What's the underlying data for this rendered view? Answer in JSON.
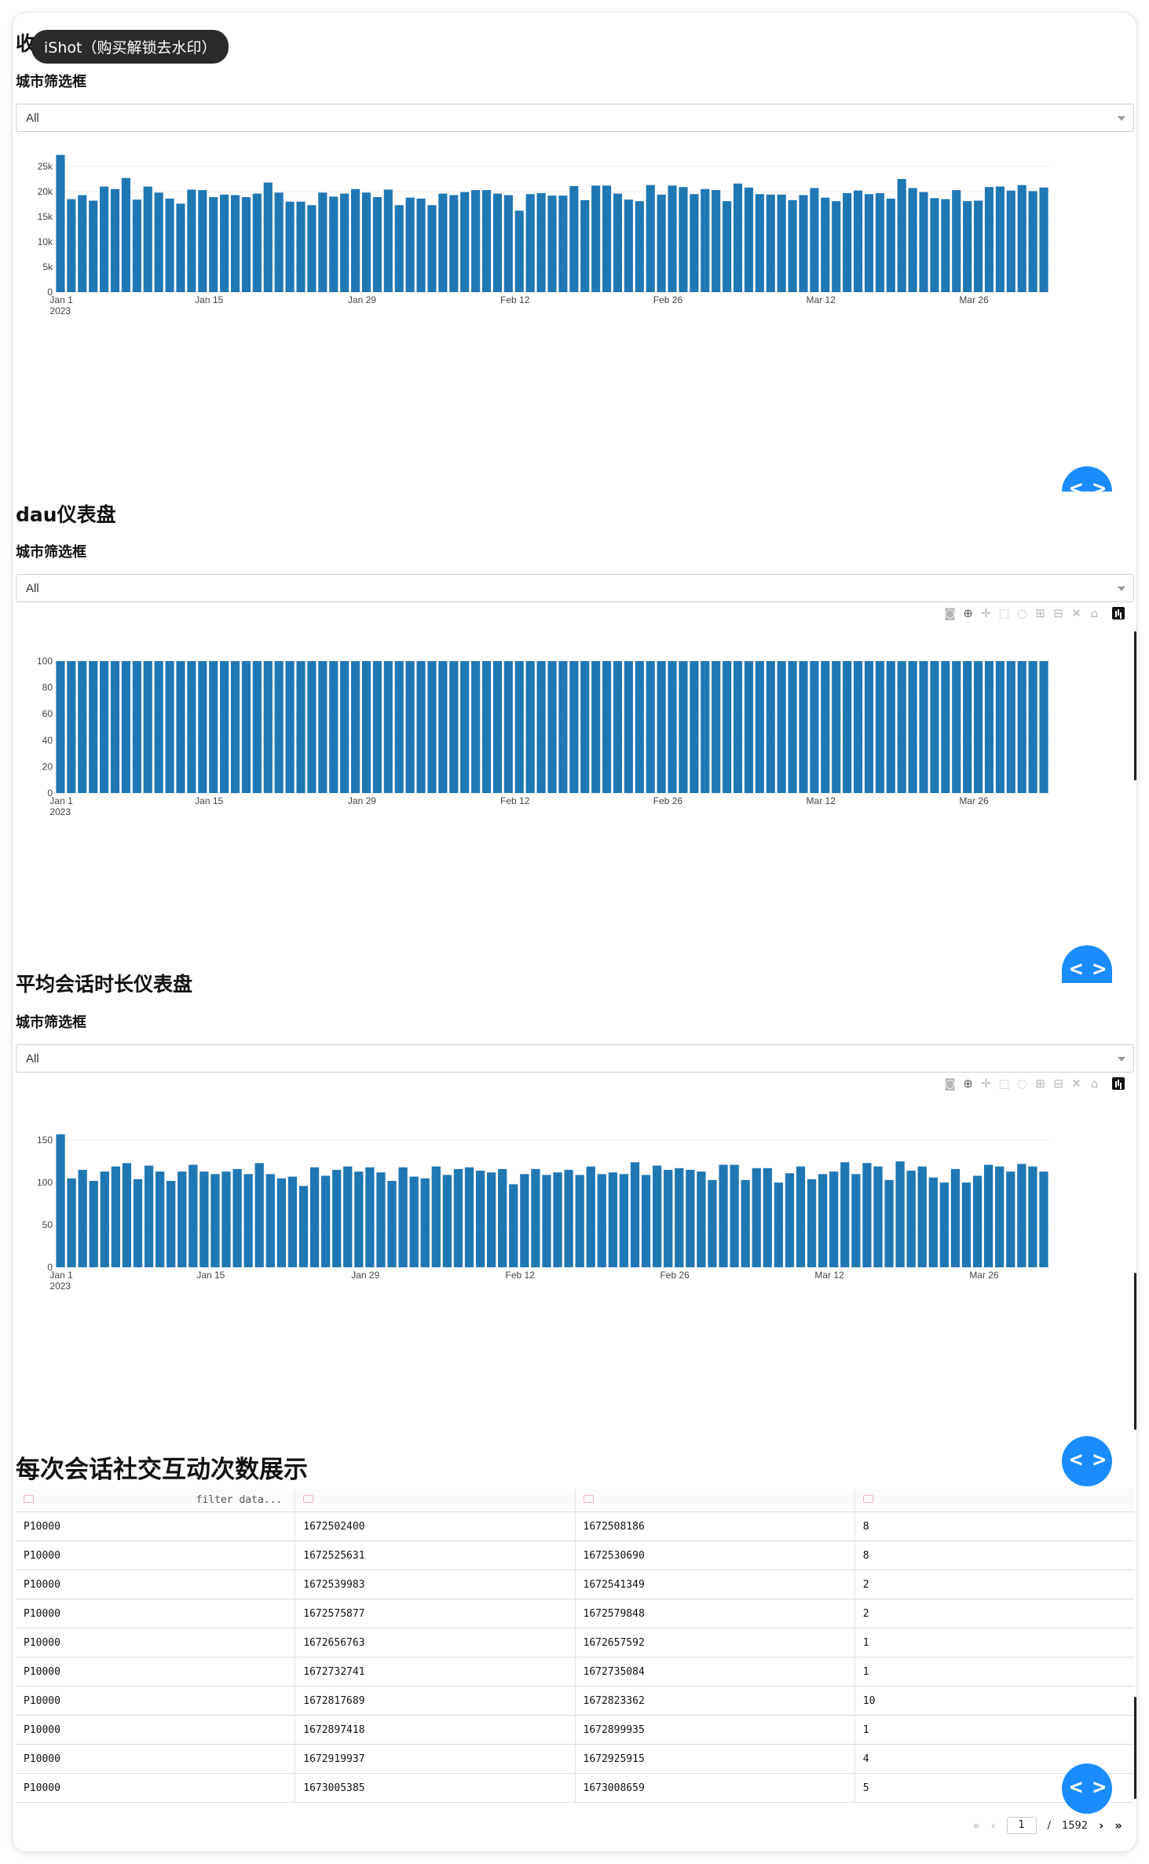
{
  "watermark": "iShot（购买解锁去水印）",
  "sections": [
    {
      "title": "收入仪表盘",
      "filter_label": "城市筛选框",
      "dropdown_value": "All"
    },
    {
      "title": "dau仪表盘",
      "filter_label": "城市筛选框",
      "dropdown_value": "All"
    },
    {
      "title": "平均会话时长仪表盘",
      "filter_label": "城市筛选框",
      "dropdown_value": "All"
    },
    {
      "title": "每次会话社交互动次数展示"
    }
  ],
  "fab_label": "< >",
  "chart_data": [
    {
      "type": "bar",
      "x_start": "2023-01-01",
      "x_end": "2023-04-01",
      "x_ticks": [
        {
          "label": "Jan 1",
          "sub": "2023",
          "day": 0
        },
        {
          "label": "Jan 15",
          "day": 14
        },
        {
          "label": "Jan 29",
          "day": 28
        },
        {
          "label": "Feb 12",
          "day": 42
        },
        {
          "label": "Feb 26",
          "day": 56
        },
        {
          "label": "Mar 12",
          "day": 70
        },
        {
          "label": "Mar 26",
          "day": 84
        }
      ],
      "y_ticks": [
        {
          "label": "0",
          "value": 0
        },
        {
          "label": "5k",
          "value": 5000
        },
        {
          "label": "10k",
          "value": 10000
        },
        {
          "label": "15k",
          "value": 15000
        },
        {
          "label": "20k",
          "value": 20000
        },
        {
          "label": "25k",
          "value": 25000
        }
      ],
      "ylim": [
        0,
        27500
      ],
      "color": "#1f77b4",
      "values": [
        27300,
        18500,
        19300,
        18200,
        21000,
        20500,
        22700,
        18400,
        21000,
        19800,
        18600,
        17600,
        20400,
        20300,
        18900,
        19400,
        19300,
        18900,
        19600,
        21800,
        19800,
        18000,
        18000,
        17300,
        19800,
        19000,
        19600,
        20500,
        19800,
        18900,
        20400,
        17300,
        18800,
        18600,
        17300,
        19600,
        19300,
        19900,
        20300,
        20300,
        19600,
        19300,
        16200,
        19500,
        19700,
        19200,
        19200,
        21100,
        18300,
        21200,
        21200,
        19600,
        18400,
        18100,
        21300,
        19400,
        21200,
        20900,
        19500,
        20500,
        20300,
        18100,
        21600,
        20800,
        19500,
        19400,
        19400,
        18300,
        19300,
        20700,
        18800,
        18100,
        19700,
        20200,
        19500,
        19700,
        18600,
        22500,
        20700,
        19900,
        18700,
        18500,
        20300,
        18100,
        18200,
        20900,
        21000,
        20200,
        21300,
        20100,
        20800
      ]
    },
    {
      "type": "bar",
      "x_start": "2023-01-01",
      "x_end": "2023-04-01",
      "x_ticks": [
        {
          "label": "Jan 1",
          "sub": "2023",
          "day": 0
        },
        {
          "label": "Jan 15",
          "day": 14
        },
        {
          "label": "Jan 29",
          "day": 28
        },
        {
          "label": "Feb 12",
          "day": 42
        },
        {
          "label": "Feb 26",
          "day": 56
        },
        {
          "label": "Mar 12",
          "day": 70
        },
        {
          "label": "Mar 26",
          "day": 84
        }
      ],
      "y_ticks": [
        {
          "label": "0",
          "value": 0
        },
        {
          "label": "20",
          "value": 20
        },
        {
          "label": "40",
          "value": 40
        },
        {
          "label": "60",
          "value": 60
        },
        {
          "label": "80",
          "value": 80
        },
        {
          "label": "100",
          "value": 100
        }
      ],
      "ylim": [
        0,
        100
      ],
      "color": "#1f77b4",
      "constant_value": 100,
      "values": [
        100,
        100,
        100,
        100,
        100,
        100,
        100,
        100,
        100,
        100,
        100,
        100,
        100,
        100,
        100,
        100,
        100,
        100,
        100,
        100,
        100,
        100,
        100,
        100,
        100,
        100,
        100,
        100,
        100,
        100,
        100,
        100,
        100,
        100,
        100,
        100,
        100,
        100,
        100,
        100,
        100,
        100,
        100,
        100,
        100,
        100,
        100,
        100,
        100,
        100,
        100,
        100,
        100,
        100,
        100,
        100,
        100,
        100,
        100,
        100,
        100,
        100,
        100,
        100,
        100,
        100,
        100,
        100,
        100,
        100,
        100,
        100,
        100,
        100,
        100,
        100,
        100,
        100,
        100,
        100,
        100,
        100,
        100,
        100,
        100,
        100,
        100,
        100,
        100,
        100,
        100
      ]
    },
    {
      "type": "bar",
      "x_start": "2023-01-01",
      "x_end": "2023-04-01",
      "x_ticks": [
        {
          "label": "Jan 1",
          "sub": "2023",
          "day": 0
        },
        {
          "label": "Jan 15",
          "day": 14
        },
        {
          "label": "Jan 29",
          "day": 28
        },
        {
          "label": "Feb 12",
          "day": 42
        },
        {
          "label": "Feb 26",
          "day": 56
        },
        {
          "label": "Mar 12",
          "day": 70
        },
        {
          "label": "Mar 26",
          "day": 84
        }
      ],
      "y_ticks": [
        {
          "label": "0",
          "value": 0
        },
        {
          "label": "50",
          "value": 50
        },
        {
          "label": "100",
          "value": 100
        },
        {
          "label": "150",
          "value": 150
        }
      ],
      "ylim": [
        0,
        165
      ],
      "color": "#1f77b4",
      "values": [
        157,
        105,
        115,
        102,
        113,
        119,
        123,
        104,
        120,
        113,
        102,
        113,
        121,
        113,
        110,
        113,
        116,
        110,
        123,
        110,
        105,
        107,
        96,
        118,
        108,
        115,
        119,
        113,
        118,
        112,
        102,
        118,
        107,
        105,
        119,
        109,
        116,
        118,
        114,
        112,
        116,
        98,
        110,
        116,
        109,
        112,
        115,
        109,
        119,
        110,
        112,
        110,
        124,
        109,
        120,
        115,
        117,
        115,
        113,
        103,
        121,
        121,
        103,
        117,
        117,
        100,
        111,
        119,
        104,
        110,
        113,
        124,
        110,
        123,
        119,
        103,
        125,
        114,
        119,
        106,
        100,
        116,
        100,
        108,
        121,
        119,
        113,
        122,
        119,
        113
      ]
    }
  ],
  "table": {
    "filter_placeholder": "filter data...",
    "rows": [
      [
        "P10000",
        "1672502400",
        "1672508186",
        "8"
      ],
      [
        "P10000",
        "1672525631",
        "1672530690",
        "8"
      ],
      [
        "P10000",
        "1672539983",
        "1672541349",
        "2"
      ],
      [
        "P10000",
        "1672575877",
        "1672579848",
        "2"
      ],
      [
        "P10000",
        "1672656763",
        "1672657592",
        "1"
      ],
      [
        "P10000",
        "1672732741",
        "1672735084",
        "1"
      ],
      [
        "P10000",
        "1672817689",
        "1672823362",
        "10"
      ],
      [
        "P10000",
        "1672897418",
        "1672899935",
        "1"
      ],
      [
        "P10000",
        "1672919937",
        "1672925915",
        "4"
      ],
      [
        "P10000",
        "1673005385",
        "1673008659",
        "5"
      ]
    ]
  },
  "pager": {
    "current_page": "1",
    "separator": "/",
    "total_pages": "1592"
  }
}
